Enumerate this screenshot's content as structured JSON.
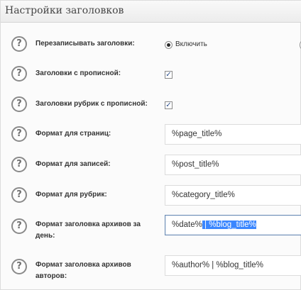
{
  "panel": {
    "title": "Настройки заголовков"
  },
  "help_glyph": "?",
  "settings": [
    {
      "label": "Перезаписывать заголовки:",
      "control": "radio",
      "option_label": "Включить"
    },
    {
      "label": "Заголовки с прописной:",
      "control": "checkbox",
      "checked": true
    },
    {
      "label": "Заголовки рубрик с прописной:",
      "control": "checkbox",
      "checked": true
    },
    {
      "label": "Формат для страниц:",
      "control": "input",
      "value": "%page_title%"
    },
    {
      "label": "Формат для записей:",
      "control": "input",
      "value": "%post_title%"
    },
    {
      "label": "Формат для рубрик:",
      "control": "input",
      "value": "%category_title%"
    },
    {
      "label_line1": "Формат заголовка архивов за",
      "label_line2": "день:",
      "control": "input",
      "value_plain": "%date%",
      "value_selected": " | %blog_title%",
      "focused": true
    },
    {
      "label_line1": "Формат заголовка архивов",
      "label_line2": "авторов:",
      "control": "input",
      "value": "%author% | %blog_title%"
    }
  ],
  "checkmark_glyph": "✓",
  "colors": {
    "selection": "#3a86ff",
    "panel_bg": "#fbfbfb",
    "label": "#333333"
  }
}
